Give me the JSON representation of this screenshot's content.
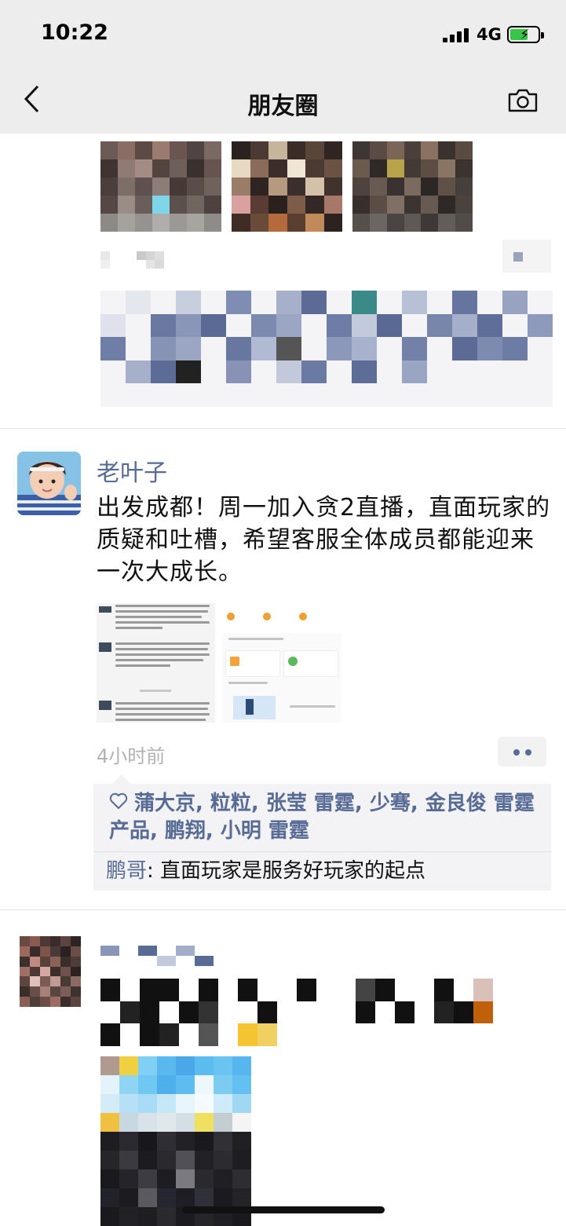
{
  "status_bar": {
    "time": "10:22",
    "network": "4G"
  },
  "nav": {
    "title": "朋友圈",
    "back_icon": "chevron-left-icon",
    "camera_icon": "camera-icon"
  },
  "post": {
    "author": "老叶子",
    "text": "出发成都！周一加入贪2直播，直面玩家的质疑和吐槽，希望客服全体成员都能迎来一次大成长。",
    "time_ago": "4小时前",
    "likes": "蒲大京, 粒粒, 张莹 雷霆, 少骞, 金良俊 雷霆 产品, 鹏翔, 小明 雷霆",
    "comment": {
      "author": "鹏哥",
      "text": "直面玩家是服务好玩家的起点"
    }
  },
  "colors": {
    "link": "#576b95",
    "bar": "#ededed",
    "comment_bg": "#f3f3f5"
  }
}
